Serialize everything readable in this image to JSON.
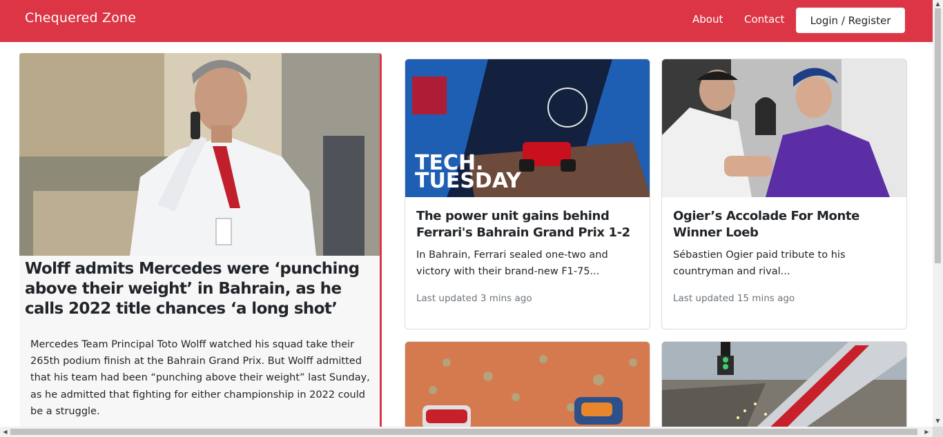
{
  "navbar": {
    "brand": "Chequered Zone",
    "links": [
      "About",
      "Contact"
    ],
    "login_label": "Login / Register",
    "color": "#dc3545"
  },
  "featured": {
    "title": "Wolff admits Mercedes were ‘punching above their weight’ in Bahrain, as he calls 2022 title chances ‘a long shot’",
    "body": "Mercedes Team Principal Toto Wolff watched his squad take their 265th podium finish at the Bahrain Grand Prix. But Wolff admitted that his team had been “punching above their weight” last Sunday, as he admitted that fighting for either championship in 2022 could be a struggle.",
    "image": "toto-wolff-photo"
  },
  "cards": [
    {
      "title": "The power unit gains behind Ferrari's Bahrain Grand Prix 1-2",
      "text": "In Bahrain, Ferrari sealed one-two and victory with their brand-new F1-75...",
      "updated": "Last updated 3 mins ago",
      "image_caption": "TECH. TUESDAY"
    },
    {
      "title": "Ogier’s Accolade For Monte Winner Loeb",
      "text": "Sébastien Ogier paid tribute to his countryman and rival...",
      "updated": "Last updated 15 mins ago",
      "image": "rally-drivers-photo"
    }
  ],
  "bottom_cards": [
    {
      "image": "desert-rally-photo"
    },
    {
      "image": "race-start-photo"
    }
  ]
}
